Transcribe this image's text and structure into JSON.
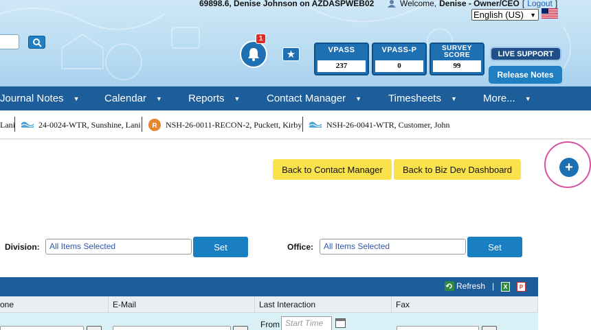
{
  "header": {
    "server_line": "69898.6, Denise Johnson on AZDASPWEB02",
    "welcome_prefix": "Welcome,",
    "welcome_user": "Denise - Owner/CEO",
    "logout_open": "[",
    "logout_label": "Logout",
    "logout_close": "]",
    "language": "English (US)",
    "notification_count": "1",
    "scores": [
      {
        "title": "VPASS",
        "value": "237"
      },
      {
        "title": "VPASS-P",
        "value": "0"
      },
      {
        "title": "SURVEY SCORE",
        "value": "99"
      }
    ],
    "live_support": "LIVE SUPPORT",
    "release_notes": "Release Notes"
  },
  "nav": {
    "items": [
      "Journal Notes",
      "Calendar",
      "Reports",
      "Contact Manager",
      "Timesheets",
      "More..."
    ]
  },
  "recent": {
    "items": [
      {
        "label": "Lani",
        "icon": "water-icon"
      },
      {
        "label": "24-0024-WTR, Sunshine, Lani",
        "icon": "water-icon"
      },
      {
        "label": "NSH-26-0011-RECON-2, Puckett, Kirby",
        "icon": "reconstruction-icon"
      },
      {
        "label": "NSH-26-0041-WTR, Customer, John",
        "icon": "water-icon"
      }
    ]
  },
  "actions": {
    "back_contact_manager": "Back to Contact Manager",
    "back_biz_dev": "Back to Biz Dev Dashboard",
    "add": "+"
  },
  "filters": {
    "division_label": "Division:",
    "division_value": "All Items Selected",
    "office_label": "Office:",
    "office_value": "All Items Selected",
    "set_label": "Set"
  },
  "grid": {
    "refresh_label": "Refresh",
    "separator": "|",
    "columns": [
      "one",
      "E-Mail",
      "Last Interaction",
      "Fax"
    ],
    "from_label": "From",
    "start_placeholder": "Start Time"
  },
  "colors": {
    "nav_bg": "#1c5d9a",
    "accent_yellow": "#fae24c",
    "button_blue": "#1a7ec3"
  }
}
